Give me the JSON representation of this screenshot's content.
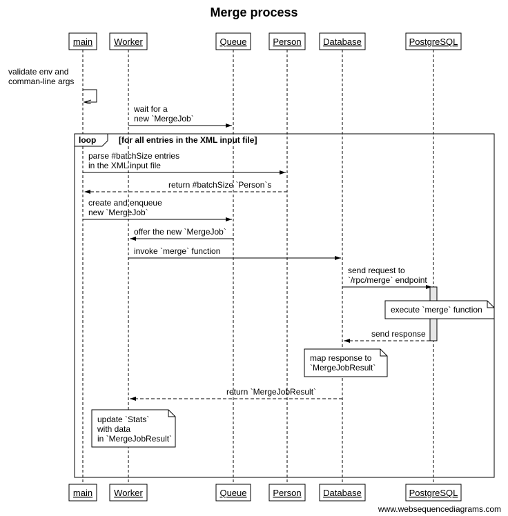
{
  "title": "Merge process",
  "participants": [
    "main",
    "Worker",
    "Queue",
    "Person",
    "Database",
    "PostgreSQL"
  ],
  "messages": {
    "selfNote": "validate env and\ncomman-line args",
    "m1": "wait for a\nnew `MergeJob`",
    "loopLabel": "loop",
    "loopCond": "[for all entries in the XML input file]",
    "m2": "parse #batchSize entries\nin the XML input file",
    "m3": "return #batchSize `Person`s",
    "m4": "create and enqueue\nnew `MergeJob`",
    "m5": "offer the new `MergeJob`",
    "m6": "invoke `merge` function",
    "m7": "send request to\n`/rpc/merge` endpoint",
    "noteExec": "execute `merge` function",
    "m8": "send response",
    "noteMap": "map response to\n`MergeJobResult`",
    "m9": "return `MergeJobResult`",
    "noteStats": "update `Stats`\nwith data\nin `MergeJobResult`",
    "credit": "www.websequencediagrams.com"
  }
}
